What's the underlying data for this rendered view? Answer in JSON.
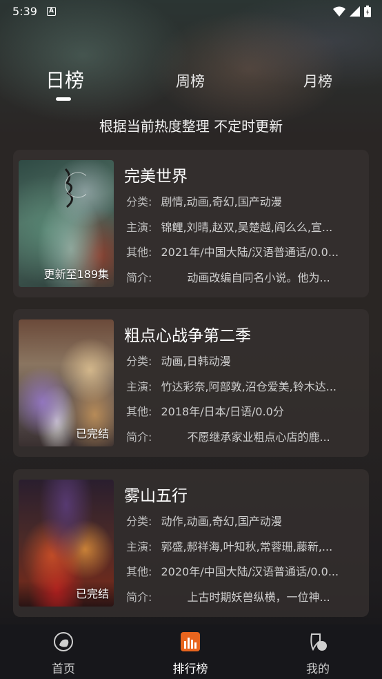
{
  "status_bar": {
    "time": "5:39",
    "app_icon_letter": "A"
  },
  "tabs": [
    {
      "label": "日榜",
      "active": true
    },
    {
      "label": "周榜",
      "active": false
    },
    {
      "label": "月榜",
      "active": false
    }
  ],
  "subtitle": "根据当前热度整理 不定时更新",
  "items": [
    {
      "title": "完美世界",
      "badge": "更新至189集",
      "category_key": "分类:",
      "category": "剧情,动画,奇幻,国产动漫",
      "cast_key": "主演:",
      "cast": "锦鲤,刘晴,赵双,吴楚越,阎么么,宣...",
      "other_key": "其他:",
      "other": "2021年/中国大陆/汉语普通话/0.0...",
      "intro_key": "简介:",
      "intro": "动画改编自同名小说。他为..."
    },
    {
      "title": "粗点心战争第二季",
      "badge": "已完结",
      "category_key": "分类:",
      "category": "动画,日韩动漫",
      "cast_key": "主演:",
      "cast": "竹达彩奈,阿部敦,沼仓爱美,铃木达...",
      "other_key": "其他:",
      "other": "2018年/日本/日语/0.0分",
      "intro_key": "简介:",
      "intro": "不愿继承家业粗点心店的鹿..."
    },
    {
      "title": "雾山五行",
      "badge": "已完结",
      "category_key": "分类:",
      "category": "动作,动画,奇幻,国产动漫",
      "cast_key": "主演:",
      "cast": "郭盛,郝祥海,叶知秋,常蓉珊,藤新,...",
      "other_key": "其他:",
      "other": "2020年/中国大陆/汉语普通话/0.0...",
      "intro_key": "简介:",
      "intro": "上古时期妖兽纵横，一位神..."
    }
  ],
  "bottom_nav": [
    {
      "label": "首页",
      "icon": "home-icon",
      "active": false
    },
    {
      "label": "排行榜",
      "icon": "ranking-icon",
      "active": true
    },
    {
      "label": "我的",
      "icon": "profile-icon",
      "active": false
    }
  ],
  "colors": {
    "accent": "#e8651e",
    "card_bg": "#37302e",
    "nav_bg": "#17171b"
  }
}
